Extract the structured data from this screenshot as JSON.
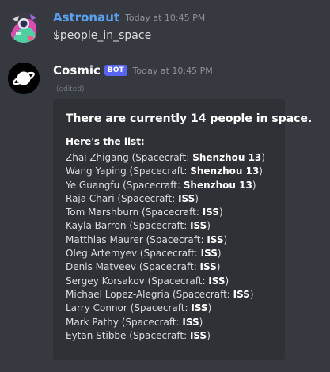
{
  "messages": [
    {
      "username": "Astronaut",
      "timestamp": "Today at 10:45 PM",
      "text": "$people_in_space",
      "avatar_icon": "astronaut-art-avatar"
    },
    {
      "username": "Cosmic",
      "bot_tag": "BOT",
      "timestamp": "Today at 10:45 PM",
      "edited": "(edited)",
      "avatar_icon": "planet-icon"
    }
  ],
  "embed": {
    "title": "There are currently 14 people in space.",
    "subtitle": "Here's the list:",
    "spacecraft_label": "Spacecraft: ",
    "people": [
      {
        "name": "Zhai Zhigang",
        "craft": "Shenzhou 13"
      },
      {
        "name": "Wang Yaping",
        "craft": "Shenzhou 13"
      },
      {
        "name": "Ye Guangfu",
        "craft": "Shenzhou 13"
      },
      {
        "name": "Raja Chari",
        "craft": "ISS"
      },
      {
        "name": "Tom Marshburn",
        "craft": "ISS"
      },
      {
        "name": "Kayla Barron",
        "craft": "ISS"
      },
      {
        "name": "Matthias Maurer",
        "craft": "ISS"
      },
      {
        "name": "Oleg Artemyev",
        "craft": "ISS"
      },
      {
        "name": "Denis Matveev",
        "craft": "ISS"
      },
      {
        "name": "Sergey Korsakov",
        "craft": "ISS"
      },
      {
        "name": "Michael Lopez-Alegria",
        "craft": "ISS"
      },
      {
        "name": "Larry Connor",
        "craft": "ISS"
      },
      {
        "name": "Mark Pathy",
        "craft": "ISS"
      },
      {
        "name": "Eytan Stibbe",
        "craft": "ISS"
      }
    ]
  },
  "colors": {
    "background": "#36393f",
    "embed_background": "#2f3136",
    "astronaut_name": "#5ba0f0",
    "bot_tag": "#5865f2"
  }
}
